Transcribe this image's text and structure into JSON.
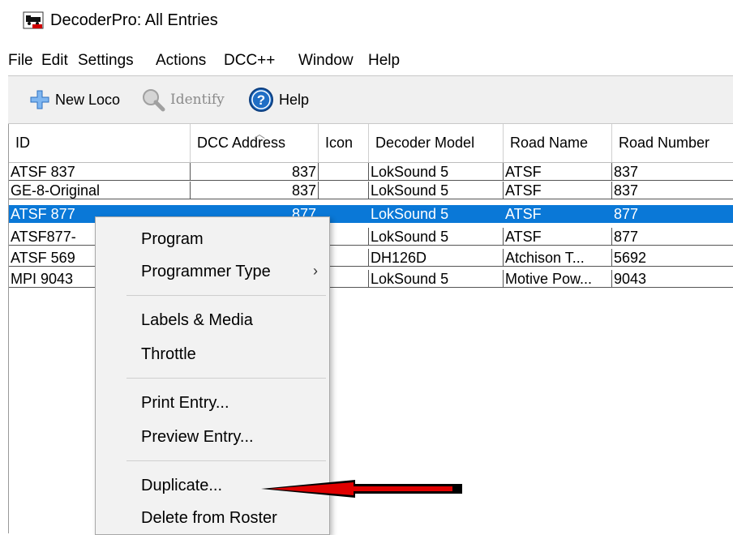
{
  "window": {
    "title": "DecoderPro: All Entries",
    "icon": "jmri-train-icon"
  },
  "menu": [
    "File",
    "Edit",
    "Settings",
    "Actions",
    "DCC++",
    "Window",
    "Help"
  ],
  "toolbar": {
    "new_loco": "New Loco",
    "identify": "Identify",
    "help": "Help"
  },
  "table": {
    "columns": [
      "ID",
      "DCC Address",
      "Icon",
      "Decoder Model",
      "Road Name",
      "Road Number"
    ],
    "rows": [
      {
        "id": "ATSF 837",
        "dcc": "837",
        "icon": "",
        "model": "LokSound 5",
        "road_name": "ATSF",
        "road_number": "837"
      },
      {
        "id": "GE-8-Original",
        "dcc": "837",
        "icon": "",
        "model": "LokSound 5",
        "road_name": "ATSF",
        "road_number": "837"
      },
      {
        "id": "ATSF 877",
        "dcc": "877",
        "icon": "",
        "model": "LokSound 5",
        "road_name": "ATSF",
        "road_number": "877"
      },
      {
        "id": "ATSF877-",
        "dcc": "",
        "icon": "",
        "model": "LokSound 5",
        "road_name": "ATSF",
        "road_number": "877"
      },
      {
        "id": "ATSF 569",
        "dcc": "",
        "icon": "",
        "model": "DH126D",
        "road_name": "Atchison T...",
        "road_number": "5692"
      },
      {
        "id": "MPI 9043",
        "dcc": "",
        "icon": "",
        "model": "LokSound 5",
        "road_name": "Motive Pow...",
        "road_number": "9043"
      }
    ],
    "selected_index": 2
  },
  "context_menu": {
    "program": "Program",
    "programmer_type": "Programmer Type",
    "labels_media": "Labels & Media",
    "throttle": "Throttle",
    "print_entry": "Print Entry...",
    "preview_entry": "Preview Entry...",
    "duplicate": "Duplicate...",
    "delete": "Delete from Roster"
  },
  "colors": {
    "selection": "#0a78d7",
    "arrow": "#e00000"
  }
}
